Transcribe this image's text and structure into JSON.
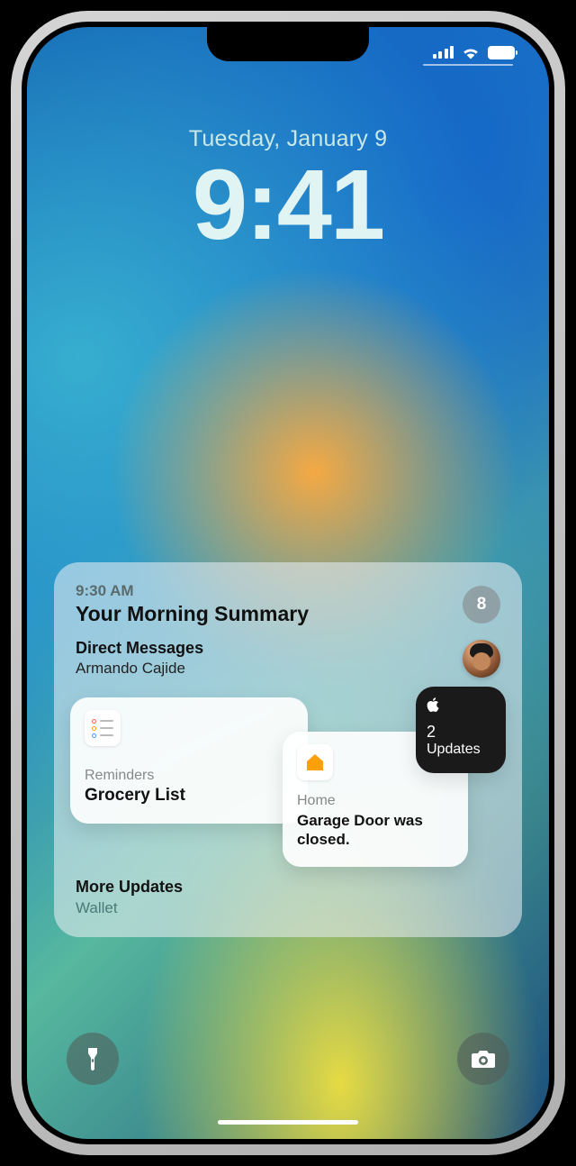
{
  "statusBar": {},
  "lock": {
    "date": "Tuesday, January 9",
    "time": "9:41"
  },
  "summary": {
    "timestamp": "9:30 AM",
    "title": "Your Morning Summary",
    "badge": "8",
    "directMessages": {
      "heading": "Direct Messages",
      "sender": "Armando Cajide"
    },
    "reminders": {
      "app": "Reminders",
      "content": "Grocery List"
    },
    "home": {
      "app": "Home",
      "content": "Garage Door was closed."
    },
    "updates": {
      "count": "2",
      "label": "Updates"
    },
    "more": {
      "heading": "More Updates",
      "app": "Wallet"
    }
  }
}
